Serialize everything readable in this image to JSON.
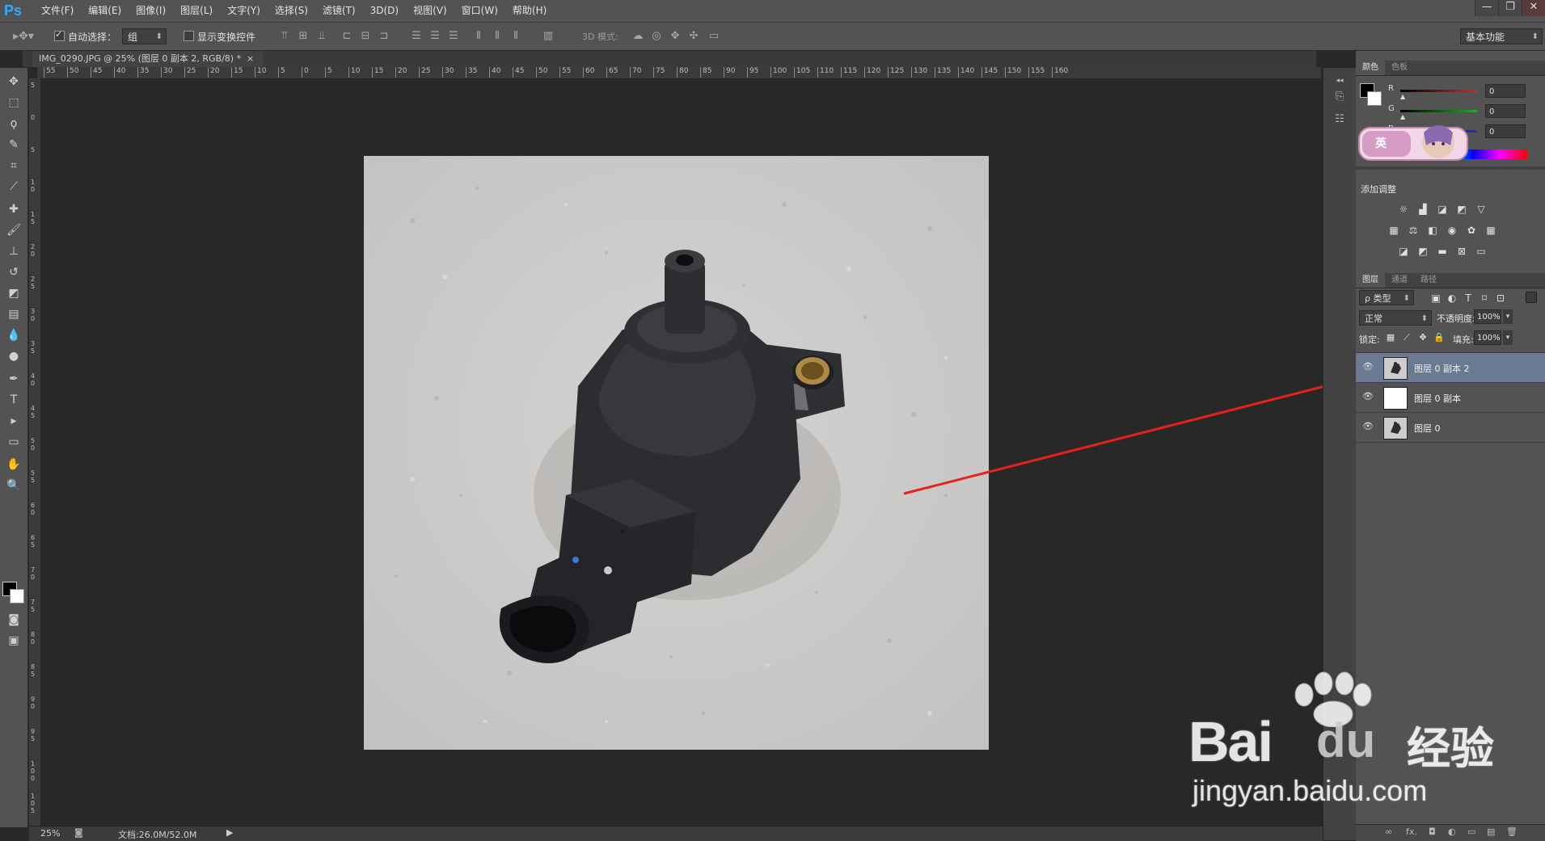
{
  "app": {
    "logo": "Ps"
  },
  "menu": [
    "文件(F)",
    "编辑(E)",
    "图像(I)",
    "图层(L)",
    "文字(Y)",
    "选择(S)",
    "滤镜(T)",
    "3D(D)",
    "视图(V)",
    "窗口(W)",
    "帮助(H)"
  ],
  "window_controls": [
    "—",
    "❐",
    "✕"
  ],
  "options": {
    "auto_select_label": "自动选择：",
    "auto_select_value": "组",
    "show_transform_label": "显示变换控件",
    "mode_3d_label": "3D 模式:",
    "workspace": "基本功能"
  },
  "document": {
    "tab_title": "IMG_0290.JPG @ 25% (图层 0 副本 2, RGB/8) *",
    "close_glyph": "×",
    "zoom": "25%",
    "doc_size": "文档:26.0M/52.0M"
  },
  "ruler_top_labels": [
    "55",
    "50",
    "45",
    "40",
    "35",
    "30",
    "25",
    "20",
    "15",
    "10",
    "5",
    "0",
    "5",
    "10",
    "15",
    "20",
    "25",
    "30",
    "35",
    "40",
    "45",
    "50",
    "55",
    "60",
    "65",
    "70",
    "75",
    "80",
    "85",
    "90",
    "95",
    "100",
    "105",
    "110",
    "115",
    "120",
    "125",
    "130",
    "135",
    "140",
    "145",
    "150",
    "155",
    "160"
  ],
  "ruler_left_labels": [
    "5",
    "0",
    "5",
    "1 0",
    "1 5",
    "2 0",
    "2 5",
    "3 0",
    "3 5",
    "4 0",
    "4 5",
    "5 0",
    "5 5",
    "6 0",
    "6 5",
    "7 0",
    "7 5",
    "8 0",
    "8 5",
    "9 0",
    "9 5",
    "1 0 0",
    "1 0 5"
  ],
  "color_panel": {
    "tabs": [
      "颜色",
      "色板"
    ],
    "channels": [
      {
        "label": "R",
        "value": "0",
        "color": "#d32a2a"
      },
      {
        "label": "G",
        "value": "0",
        "color": "#2aa82a"
      },
      {
        "label": "B",
        "value": "0",
        "color": "#2a2ad3"
      }
    ]
  },
  "adjustments": {
    "title": "添加调整"
  },
  "ime": {
    "label": "英"
  },
  "layers_panel": {
    "tabs": [
      "图层",
      "通道",
      "路径"
    ],
    "filter_label": "ρ 类型",
    "blend_mode": "正常",
    "opacity_label": "不透明度:",
    "opacity_value": "100%",
    "lock_label": "锁定:",
    "fill_label": "填充:",
    "fill_value": "100%",
    "layers": [
      {
        "name": "图层 0 副本 2",
        "selected": true,
        "thumb": "photo"
      },
      {
        "name": "图层 0 副本",
        "selected": false,
        "thumb": "white"
      },
      {
        "name": "图层 0",
        "selected": false,
        "thumb": "photo"
      }
    ],
    "footer_icons": [
      "∞",
      "fx.",
      "◘",
      "◐",
      "▭",
      "▤",
      "🗑"
    ]
  },
  "watermark": {
    "brand": "Bai",
    "brand_du": "du",
    "brand_cn": "经验",
    "url": "jingyan.baidu.com"
  },
  "colors": {
    "accent_arrow": "#e8201c",
    "panel_bg": "#535353",
    "canvas_bg": "#282828",
    "selected_layer": "#6b7a93"
  }
}
